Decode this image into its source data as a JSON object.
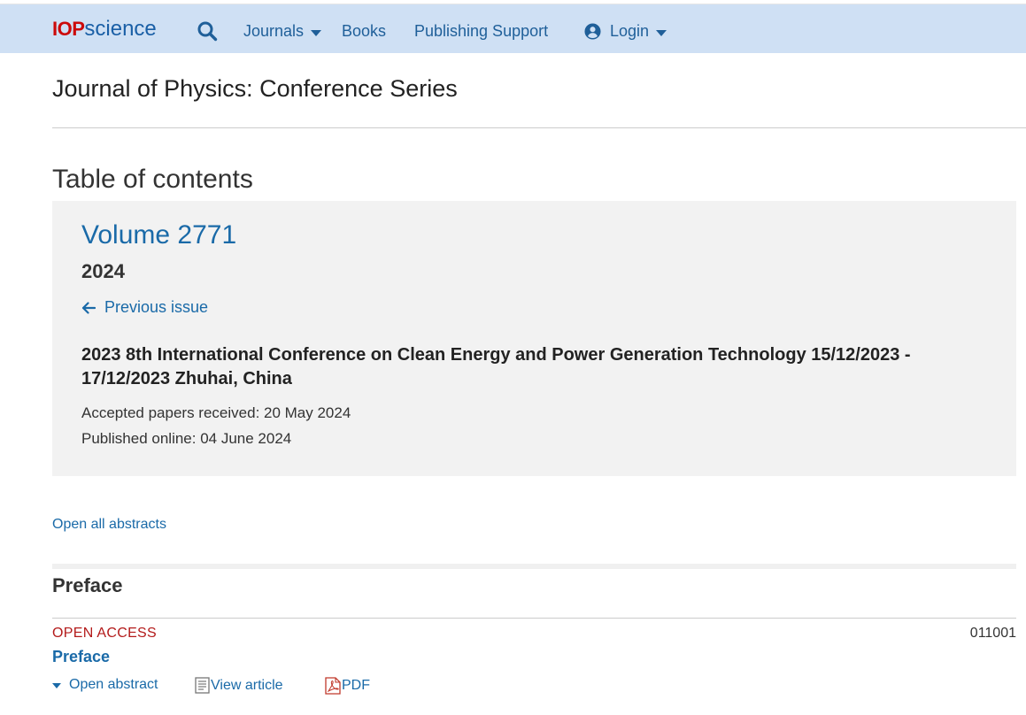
{
  "header": {
    "logo_iop": "IOP",
    "logo_science": "science",
    "nav": [
      {
        "label": "Journals",
        "has_dropdown": true
      },
      {
        "label": "Books",
        "has_dropdown": false
      },
      {
        "label": "Publishing Support",
        "has_dropdown": false
      },
      {
        "label": "Login",
        "has_dropdown": true
      }
    ],
    "colors": {
      "bar": "#cfe0f4",
      "link": "#1f5f99",
      "logo_red": "#cc0a0a"
    }
  },
  "journal_title": "Journal of Physics: Conference Series",
  "toc_heading": "Table of contents",
  "issue": {
    "volume": "Volume 2771",
    "year": "2024",
    "previous_issue": "Previous issue",
    "conference": "2023 8th International Conference on Clean Energy and Power Generation Technology 15/12/2023 - 17/12/2023 Zhuhai, China",
    "accepted": "Accepted papers received: 20 May 2024",
    "published": "Published online: 04 June 2024"
  },
  "open_all_abstracts": "Open all abstracts",
  "section": {
    "title": "Preface",
    "articles": [
      {
        "access": "OPEN ACCESS",
        "number": "011001",
        "title": "Preface",
        "actions": {
          "abstract": "Open abstract",
          "view": "View article",
          "pdf": "PDF"
        }
      }
    ]
  }
}
